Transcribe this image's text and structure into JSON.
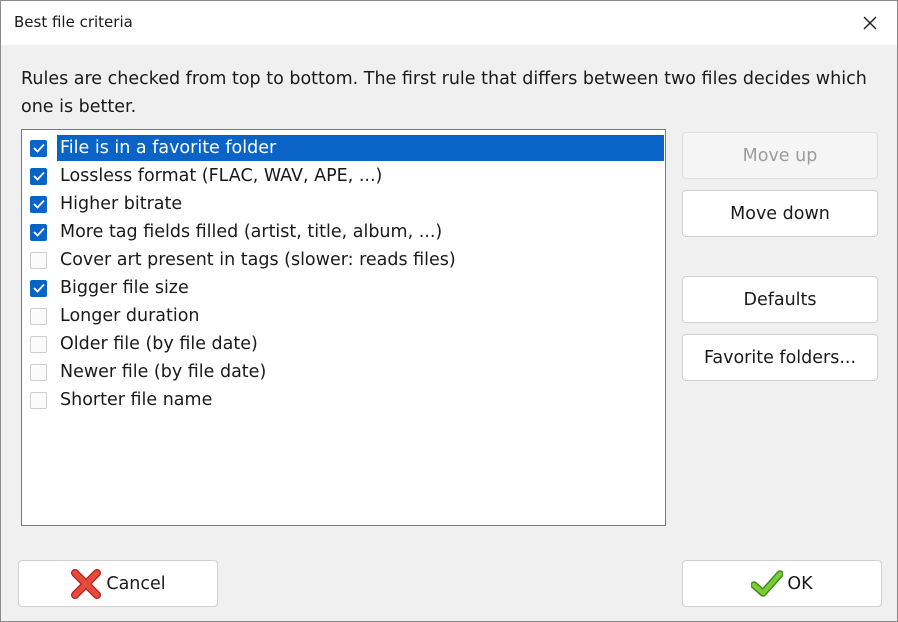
{
  "window": {
    "title": "Best file criteria"
  },
  "description": "Rules are checked from top to bottom. The first rule that differs between two files decides which one is better.",
  "rules": [
    {
      "label": "File is in a favorite folder",
      "checked": true,
      "selected": true
    },
    {
      "label": "Lossless format (FLAC, WAV, APE, ...)",
      "checked": true,
      "selected": false
    },
    {
      "label": "Higher bitrate",
      "checked": true,
      "selected": false
    },
    {
      "label": "More tag fields filled (artist, title, album, ...)",
      "checked": true,
      "selected": false
    },
    {
      "label": "Cover art present in tags (slower: reads files)",
      "checked": false,
      "selected": false
    },
    {
      "label": "Bigger file size",
      "checked": true,
      "selected": false
    },
    {
      "label": "Longer duration",
      "checked": false,
      "selected": false
    },
    {
      "label": "Older file (by file date)",
      "checked": false,
      "selected": false
    },
    {
      "label": "Newer file (by file date)",
      "checked": false,
      "selected": false
    },
    {
      "label": "Shorter file name",
      "checked": false,
      "selected": false
    }
  ],
  "buttons": {
    "move_up": "Move up",
    "move_up_enabled": false,
    "move_down": "Move down",
    "defaults": "Defaults",
    "favorite_folders": "Favorite folders...",
    "cancel": "Cancel",
    "ok": "OK"
  },
  "icons": {
    "close": "close-icon",
    "cancel": "red-x-icon",
    "ok": "green-check-icon"
  },
  "colors": {
    "accent": "#0a64c8",
    "cancel_icon": "#e03a2e",
    "ok_icon": "#5cb82a"
  }
}
